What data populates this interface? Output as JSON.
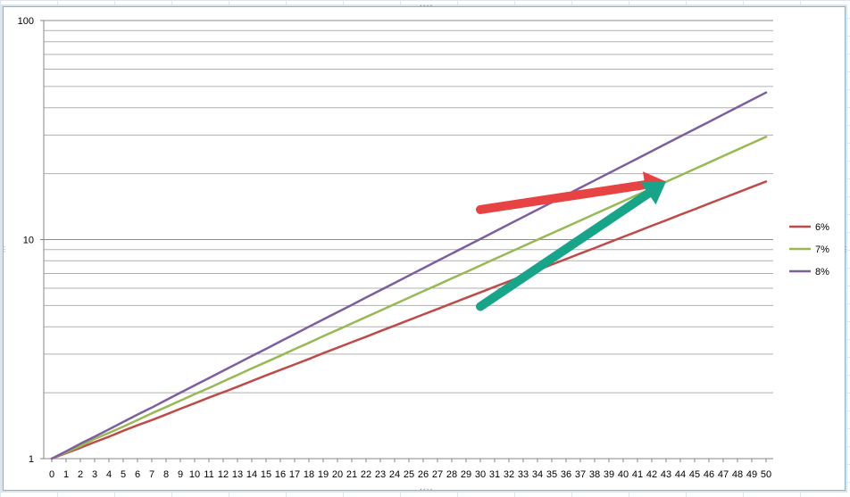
{
  "chart_data": {
    "type": "line",
    "title": "",
    "xlabel": "",
    "ylabel": "",
    "y_scale": "log",
    "ylim": [
      1,
      100
    ],
    "y_ticks": [
      "1",
      "10",
      "100"
    ],
    "grid": "horizontal major and minor gridlines",
    "legend_position": "right",
    "x": [
      0,
      1,
      2,
      3,
      4,
      5,
      6,
      7,
      8,
      9,
      10,
      11,
      12,
      13,
      14,
      15,
      16,
      17,
      18,
      19,
      20,
      21,
      22,
      23,
      24,
      25,
      26,
      27,
      28,
      29,
      30,
      31,
      32,
      33,
      34,
      35,
      36,
      37,
      38,
      39,
      40,
      41,
      42,
      43,
      44,
      45,
      46,
      47,
      48,
      49,
      50
    ],
    "series": [
      {
        "name": "6%",
        "color": "#be4b48",
        "rate": 0.06,
        "values": [
          1,
          1.06,
          1.12,
          1.19,
          1.26,
          1.34,
          1.42,
          1.5,
          1.59,
          1.69,
          1.79,
          1.9,
          2.01,
          2.13,
          2.26,
          2.4,
          2.54,
          2.69,
          2.85,
          3.03,
          3.21,
          3.4,
          3.6,
          3.82,
          4.05,
          4.29,
          4.55,
          4.82,
          5.11,
          5.42,
          5.74,
          6.09,
          6.45,
          6.84,
          7.25,
          7.69,
          8.15,
          8.64,
          9.15,
          9.7,
          10.29,
          10.9,
          11.56,
          12.25,
          12.99,
          13.76,
          14.59,
          15.47,
          16.39,
          17.38,
          18.42
        ]
      },
      {
        "name": "7%",
        "color": "#98b954",
        "rate": 0.07,
        "values": [
          1,
          1.07,
          1.14,
          1.23,
          1.31,
          1.4,
          1.5,
          1.61,
          1.72,
          1.84,
          1.97,
          2.1,
          2.25,
          2.41,
          2.58,
          2.76,
          2.95,
          3.16,
          3.38,
          3.62,
          3.87,
          4.14,
          4.43,
          4.74,
          5.07,
          5.43,
          5.81,
          6.21,
          6.65,
          7.11,
          7.61,
          8.15,
          8.72,
          9.33,
          9.98,
          10.68,
          11.42,
          12.22,
          13.08,
          13.99,
          14.97,
          16.02,
          17.14,
          18.34,
          19.63,
          21,
          22.47,
          24.05,
          25.73,
          27.53,
          29.46
        ]
      },
      {
        "name": "8%",
        "color": "#7d5fa0",
        "rate": 0.08,
        "values": [
          1,
          1.08,
          1.17,
          1.26,
          1.36,
          1.47,
          1.59,
          1.71,
          1.85,
          2,
          2.16,
          2.33,
          2.52,
          2.72,
          2.94,
          3.17,
          3.43,
          3.7,
          4,
          4.32,
          4.66,
          5.03,
          5.44,
          5.87,
          6.34,
          6.85,
          7.4,
          7.99,
          8.63,
          9.32,
          10.06,
          10.87,
          11.74,
          12.68,
          13.69,
          14.79,
          15.97,
          17.25,
          18.63,
          20.12,
          21.72,
          23.46,
          25.34,
          27.37,
          29.56,
          31.92,
          34.47,
          37.23,
          40.21,
          43.43,
          46.9
        ]
      }
    ],
    "annotations": [
      {
        "type": "arrow",
        "color": "#e84343",
        "from": [
          30,
          13.7
        ],
        "to": [
          43,
          18.4
        ]
      },
      {
        "type": "arrow",
        "color": "#17a58a",
        "from": [
          30,
          4.95
        ],
        "to": [
          43,
          18.4
        ]
      }
    ]
  }
}
